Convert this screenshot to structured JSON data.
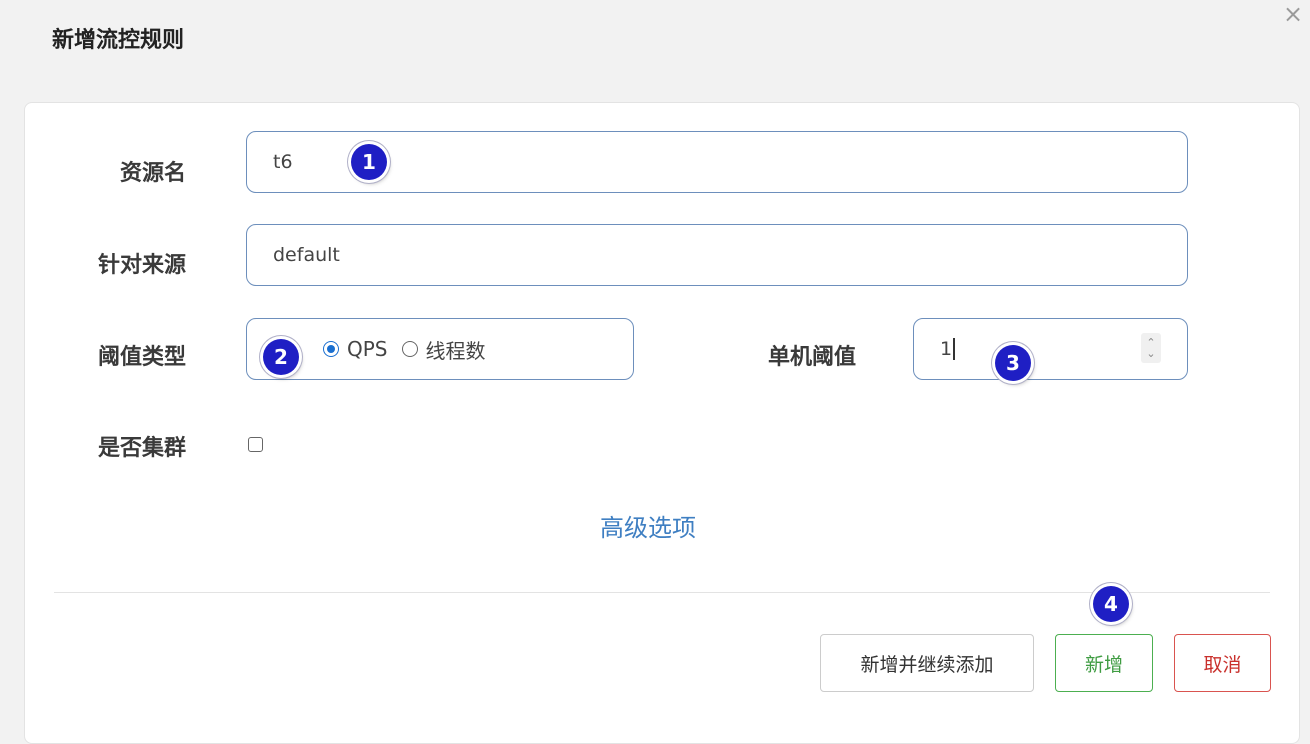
{
  "dialog": {
    "title": "新增流控规则",
    "close_glyph": "×"
  },
  "form": {
    "resource_label": "资源名",
    "resource_value": "t6",
    "source_label": "针对来源",
    "source_value": "default",
    "threshold_type_label": "阈值类型",
    "threshold_type_options": [
      "QPS",
      "线程数"
    ],
    "threshold_type_selected": "QPS",
    "single_threshold_label": "单机阈值",
    "single_threshold_value": "1",
    "cluster_label": "是否集群",
    "cluster_checked": false,
    "advanced_link": "高级选项"
  },
  "buttons": {
    "add_continue": "新增并继续添加",
    "add": "新增",
    "cancel": "取消"
  },
  "annotations": [
    "1",
    "2",
    "3",
    "4"
  ],
  "colors": {
    "input_border": "#6d8fbc",
    "link": "#3f7fc2",
    "success": "#4caf50",
    "danger": "#d9534f",
    "badge": "#1f1fc4"
  }
}
